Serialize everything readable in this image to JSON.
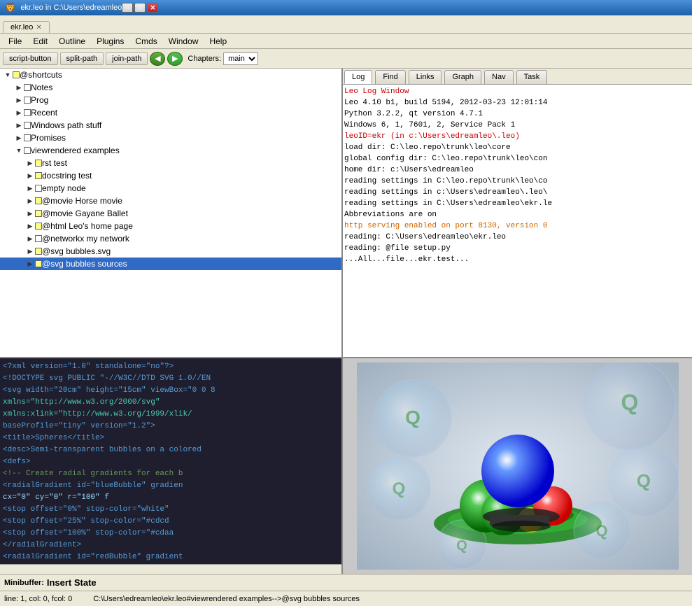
{
  "titlebar": {
    "text": "ekr.leo in C:\\Users\\edreamleo",
    "minimize": "─",
    "maximize": "□",
    "close": "✕"
  },
  "tabs": [
    {
      "label": "ekr.leo",
      "active": true
    }
  ],
  "menu": {
    "items": [
      "File",
      "Edit",
      "Outline",
      "Plugins",
      "Cmds",
      "Window",
      "Help"
    ]
  },
  "toolbar": {
    "script_button": "script-button",
    "split_path": "split-path",
    "join_path": "join-path",
    "chapters_label": "Chapters:",
    "chapters_value": "main"
  },
  "tree": {
    "items": [
      {
        "indent": 0,
        "expanded": true,
        "icon": "yellow",
        "label": "@shortcuts",
        "level": 0
      },
      {
        "indent": 1,
        "expanded": false,
        "icon": "plain",
        "label": "Notes",
        "level": 1
      },
      {
        "indent": 1,
        "expanded": false,
        "icon": "plain",
        "label": "Prog",
        "level": 1
      },
      {
        "indent": 1,
        "expanded": false,
        "icon": "plain",
        "label": "Recent",
        "level": 1
      },
      {
        "indent": 1,
        "expanded": false,
        "icon": "plain",
        "label": "Windows path stuff",
        "level": 1
      },
      {
        "indent": 1,
        "expanded": false,
        "icon": "plain",
        "label": "Promises",
        "level": 1
      },
      {
        "indent": 1,
        "expanded": true,
        "icon": "plain",
        "label": "viewrendered examples",
        "level": 1
      },
      {
        "indent": 2,
        "expanded": false,
        "icon": "yellow",
        "label": "rst test",
        "level": 2
      },
      {
        "indent": 2,
        "expanded": false,
        "icon": "yellow",
        "label": "docstring test",
        "level": 2
      },
      {
        "indent": 2,
        "expanded": false,
        "icon": "plain",
        "label": "empty node",
        "level": 2
      },
      {
        "indent": 2,
        "expanded": false,
        "icon": "yellow",
        "label": "@movie Horse movie",
        "level": 2
      },
      {
        "indent": 2,
        "expanded": false,
        "icon": "yellow",
        "label": "@movie Gayane Ballet",
        "level": 2
      },
      {
        "indent": 2,
        "expanded": false,
        "icon": "yellow",
        "label": "@html Leo's home page",
        "level": 2
      },
      {
        "indent": 2,
        "expanded": false,
        "icon": "plain",
        "label": "@networkx my network",
        "level": 2
      },
      {
        "indent": 2,
        "expanded": false,
        "icon": "yellow",
        "label": "@svg bubbles.svg",
        "level": 2
      },
      {
        "indent": 2,
        "expanded": false,
        "icon": "yellow",
        "label": "@svg bubbles sources",
        "level": 2,
        "selected": true
      }
    ]
  },
  "log_tabs": [
    "Log",
    "Find",
    "Links",
    "Graph",
    "Nav",
    "Task"
  ],
  "log_active": "Log",
  "log_lines": [
    {
      "text": "Leo Log Window",
      "style": "red"
    },
    {
      "text": "Leo 4.10 b1, build 5194, 2012-03-23 12:01:14",
      "style": "black"
    },
    {
      "text": "Python 3.2.2, qt version 4.7.1",
      "style": "black"
    },
    {
      "text": "Windows 6, 1, 7601, 2, Service Pack 1",
      "style": "black"
    },
    {
      "text": "leoID=ekr (in c:\\Users\\edreamleo\\.leo)",
      "style": "red"
    },
    {
      "text": "load dir: C:\\leo.repo\\trunk\\leo\\core",
      "style": "black"
    },
    {
      "text": "global config dir: C:\\leo.repo\\trunk\\leo\\con",
      "style": "black"
    },
    {
      "text": "home dir: c:\\Users\\edreamleo",
      "style": "black"
    },
    {
      "text": "reading settings in C:\\leo.repo\\trunk\\leo\\co",
      "style": "black"
    },
    {
      "text": "reading settings in c:\\Users\\edreamleo\\.leo\\",
      "style": "black"
    },
    {
      "text": "reading settings in C:\\Users\\edreamleo\\ekr.le",
      "style": "black"
    },
    {
      "text": "Abbreviations are on",
      "style": "black"
    },
    {
      "text": "http serving enabled on port 8130, version 0",
      "style": "orange"
    },
    {
      "text": "reading: C:\\Users\\edreamleo\\ekr.leo",
      "style": "black"
    },
    {
      "text": "reading: @file setup.py",
      "style": "black"
    },
    {
      "text": "...All...file...ekr.test...",
      "style": "black"
    }
  ],
  "editor": {
    "lines": [
      {
        "text": "<?xml version=\"1.0\" standalone=\"no\"?>",
        "style": "tag"
      },
      {
        "text": "<!DOCTYPE svg PUBLIC \"-//W3C//DTD SVG 1.0//EN",
        "style": "tag"
      },
      {
        "text": "<svg width=\"20cm\" height=\"15cm\" viewBox=\"0 0 8",
        "style": "tag"
      },
      {
        "text": "    xmlns=\"http://www.w3.org/2000/svg\"",
        "style": "mixed"
      },
      {
        "text": "    xmlns:xlink=\"http://www.w3.org/1999/xlik/",
        "style": "mixed"
      },
      {
        "text": "    baseProfile=\"tiny\" version=\"1.2\">",
        "style": "tag"
      },
      {
        "text": "<title>Spheres</title>",
        "style": "tag"
      },
      {
        "text": "<desc>Semi-transparent bubbles on a colored",
        "style": "tag"
      },
      {
        "text": "    <defs>",
        "style": "tag"
      },
      {
        "text": "        <!-- Create radial gradients for each b",
        "style": "comment"
      },
      {
        "text": "        <radialGradient id=\"blueBubble\" gradien",
        "style": "tag"
      },
      {
        "text": "                cx=\"0\" cy=\"0\" r=\"100\" f",
        "style": "attr"
      },
      {
        "text": "            <stop offset=\"0%\" stop-color=\"white\"",
        "style": "tag"
      },
      {
        "text": "            <stop offset=\"25%\" stop-color=\"#cdcd",
        "style": "tag"
      },
      {
        "text": "            <stop offset=\"100%\" stop-color=\"#cdaa",
        "style": "tag"
      },
      {
        "text": "        </radialGradient>",
        "style": "tag"
      },
      {
        "text": "        <radialGradient id=\"redBubble\" gradient",
        "style": "tag"
      }
    ]
  },
  "status": {
    "minibuffer_label": "Minibuffer:",
    "minibuffer_value": "Insert State",
    "line_col": "line: 1, col: 0, fcol: 0",
    "path": "C:\\Users\\edreamleo\\ekr.leo#viewrendered examples-->@svg bubbles sources"
  }
}
